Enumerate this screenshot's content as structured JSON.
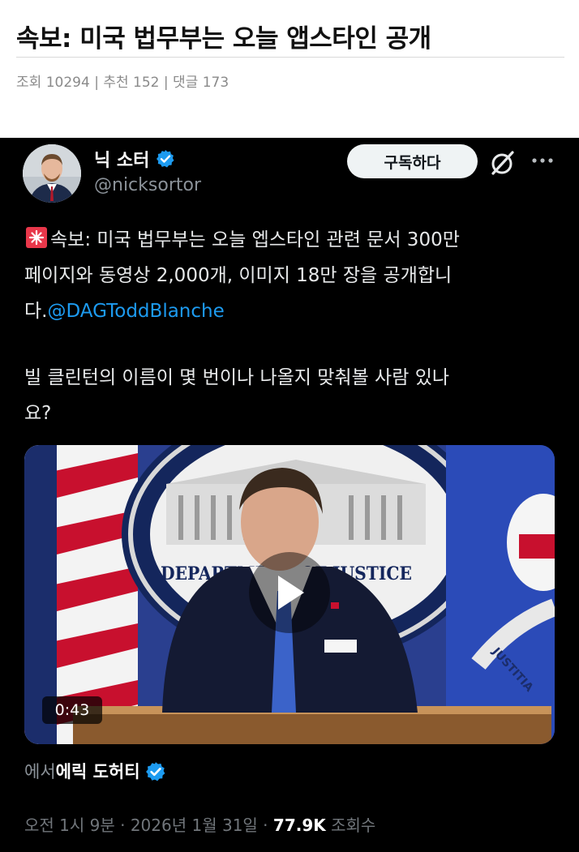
{
  "article": {
    "title": "속보: 미국 법무부는 오늘 앱스타인 공개",
    "views_label": "조회",
    "views": "10294",
    "recommend_label": "추천",
    "recommend": "152",
    "comments_label": "댓글",
    "comments": "173",
    "separator": "|"
  },
  "tweet": {
    "author_name": "닉 소터",
    "author_handle": "@nicksortor",
    "subscribe_label": "구독하다",
    "text_lines": [
      "속보: 미국 법무부는 오늘 엡스타인 관련 문서 300만",
      "페이지와 동영상 2,000개, 이미지 18만 장을 공개합니",
      "다."
    ],
    "mention": "@DAGToddBlanche",
    "question_lines": [
      "빌 클린턴의 이름이 몇 번이나 나올지 맞춰볼 사람 있나",
      "요?"
    ],
    "video": {
      "duration": "0:43",
      "podium_text": "DEPARTMENT OF JUSTICE",
      "flag_text": "JUSTITIA"
    },
    "source_prefix": "에서",
    "source_name": "에릭 도허티",
    "timestamp": "오전 1시 9분 · 2026년 1월 31일 · ",
    "views": "77.9K",
    "views_label": "조회수"
  },
  "colors": {
    "tweet_bg": "#000000",
    "mention_blue": "#1d9bf0",
    "verified_blue": "#1d9bf0",
    "subscribe_bg": "#eff3f4"
  },
  "icons": [
    "verified-badge-icon",
    "grok-icon",
    "more-icon",
    "siren-emoji-icon",
    "play-icon"
  ]
}
